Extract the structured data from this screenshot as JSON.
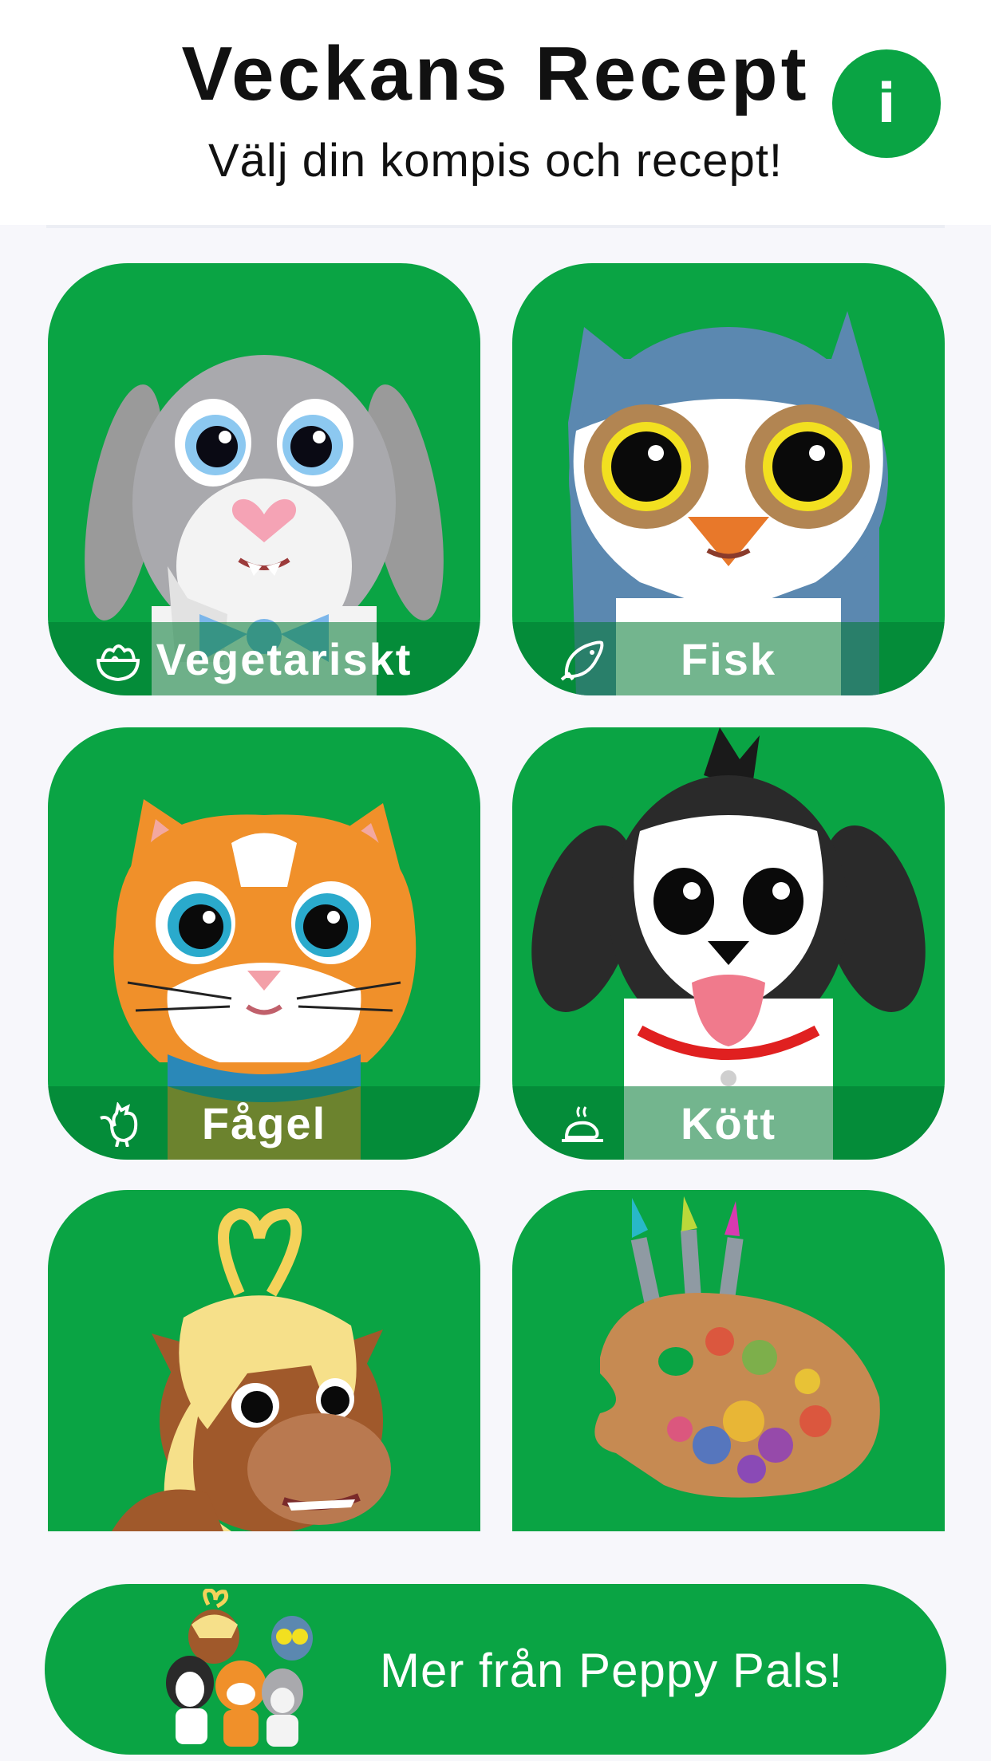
{
  "header": {
    "title": "Veckans Recept",
    "subtitle": "Välj din kompis och recept!",
    "info_label": "i"
  },
  "cards": [
    {
      "label": "Vegetariskt",
      "icon": "salad-bowl-icon",
      "character": "bunny"
    },
    {
      "label": "Fisk",
      "icon": "fish-icon",
      "character": "owl"
    },
    {
      "label": "Fågel",
      "icon": "rooster-icon",
      "character": "cat"
    },
    {
      "label": "Kött",
      "icon": "roast-meat-icon",
      "character": "dog"
    },
    {
      "label": "",
      "icon": "",
      "character": "pony"
    },
    {
      "label": "",
      "icon": "",
      "character": "paint-palette"
    }
  ],
  "promo": {
    "label": "Mer från Peppy Pals!"
  },
  "colors": {
    "brand_green": "#0aa444",
    "background": "#f7f7fb"
  }
}
